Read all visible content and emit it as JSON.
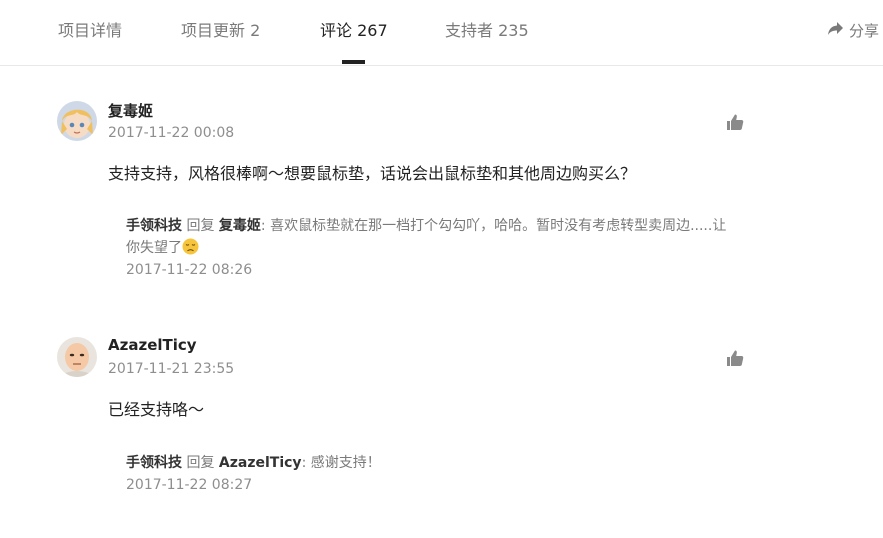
{
  "tabs": [
    {
      "label": "项目详情"
    },
    {
      "label": "项目更新 2"
    },
    {
      "label": "评论 267"
    },
    {
      "label": "支持者 235"
    }
  ],
  "share": {
    "label": "分享"
  },
  "comments": [
    {
      "author": "复毒姬",
      "time": "2017-11-22 00:08",
      "content": "支持支持，风格很棒啊～想要鼠标垫，话说会出鼠标垫和其他周边购买么？",
      "reply": {
        "from": "手领科技",
        "verb": "回复",
        "to": "复毒姬",
        "sep": ":",
        "text": "喜欢鼠标垫就在那一档打个勾勾吖，哈哈。暂时没有考虑转型卖周边.....让",
        "text2": "你失望了",
        "emoji": "disappointed-face-emoji",
        "time": "2017-11-22 08:26"
      }
    },
    {
      "author": "AzazelTicy",
      "time": "2017-11-21 23:55",
      "content": "已经支持咯～",
      "reply": {
        "from": "手领科技",
        "verb": "回复",
        "to": "AzazelTicy",
        "sep": ":",
        "text": "感谢支持！",
        "time": "2017-11-22 08:27"
      }
    }
  ],
  "icons": {
    "share": "share-arrow-icon",
    "like": "thumbs-up-icon"
  },
  "colors": {
    "text": "#222222",
    "muted": "#7a7a7a",
    "indicator": "#222222"
  }
}
